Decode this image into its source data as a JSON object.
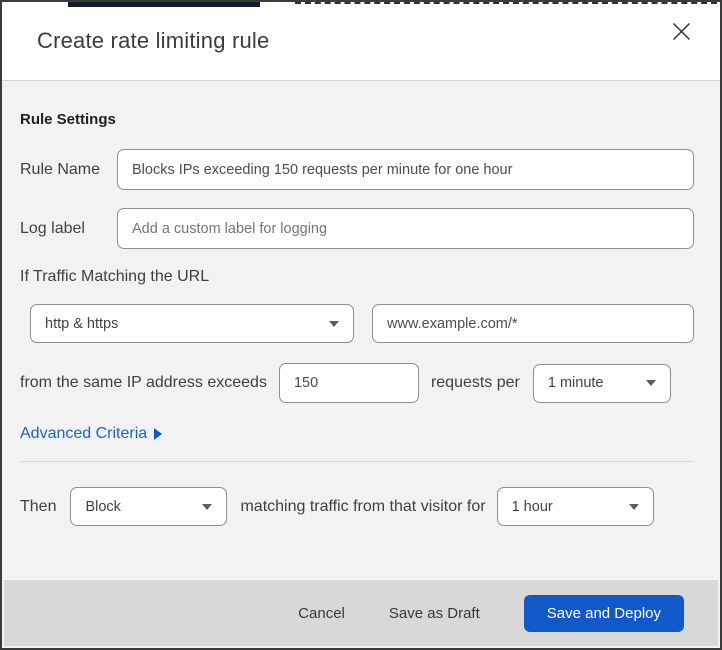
{
  "modal": {
    "title": "Create rate limiting rule"
  },
  "rule_settings": {
    "heading": "Rule Settings",
    "rule_name": {
      "label": "Rule Name",
      "value": "Blocks IPs exceeding 150 requests per minute for one hour"
    },
    "log_label": {
      "label": "Log label",
      "placeholder": "Add a custom label for logging"
    }
  },
  "match": {
    "intro": "If Traffic Matching the URL",
    "scheme_select": {
      "value": "http & https"
    },
    "url_input": {
      "value": "www.example.com/*"
    },
    "threshold_prefix": "from the same IP address exceeds",
    "threshold_value": "150",
    "threshold_suffix": "requests per",
    "period_select": {
      "value": "1 minute"
    },
    "advanced_link_label": "Advanced Criteria"
  },
  "action": {
    "then_label": "Then",
    "action_select": {
      "value": "Block"
    },
    "middle_text": "matching traffic from that visitor for",
    "duration_select": {
      "value": "1 hour"
    }
  },
  "footer": {
    "cancel_label": "Cancel",
    "save_draft_label": "Save as Draft",
    "save_deploy_label": "Save and Deploy"
  },
  "colors": {
    "primary_button": "#1159c8",
    "link_blue": "#1b65c6",
    "body_background": "#f2f2f2",
    "footer_background": "#d8d8d8",
    "border_dark": "#3b3b3b"
  }
}
